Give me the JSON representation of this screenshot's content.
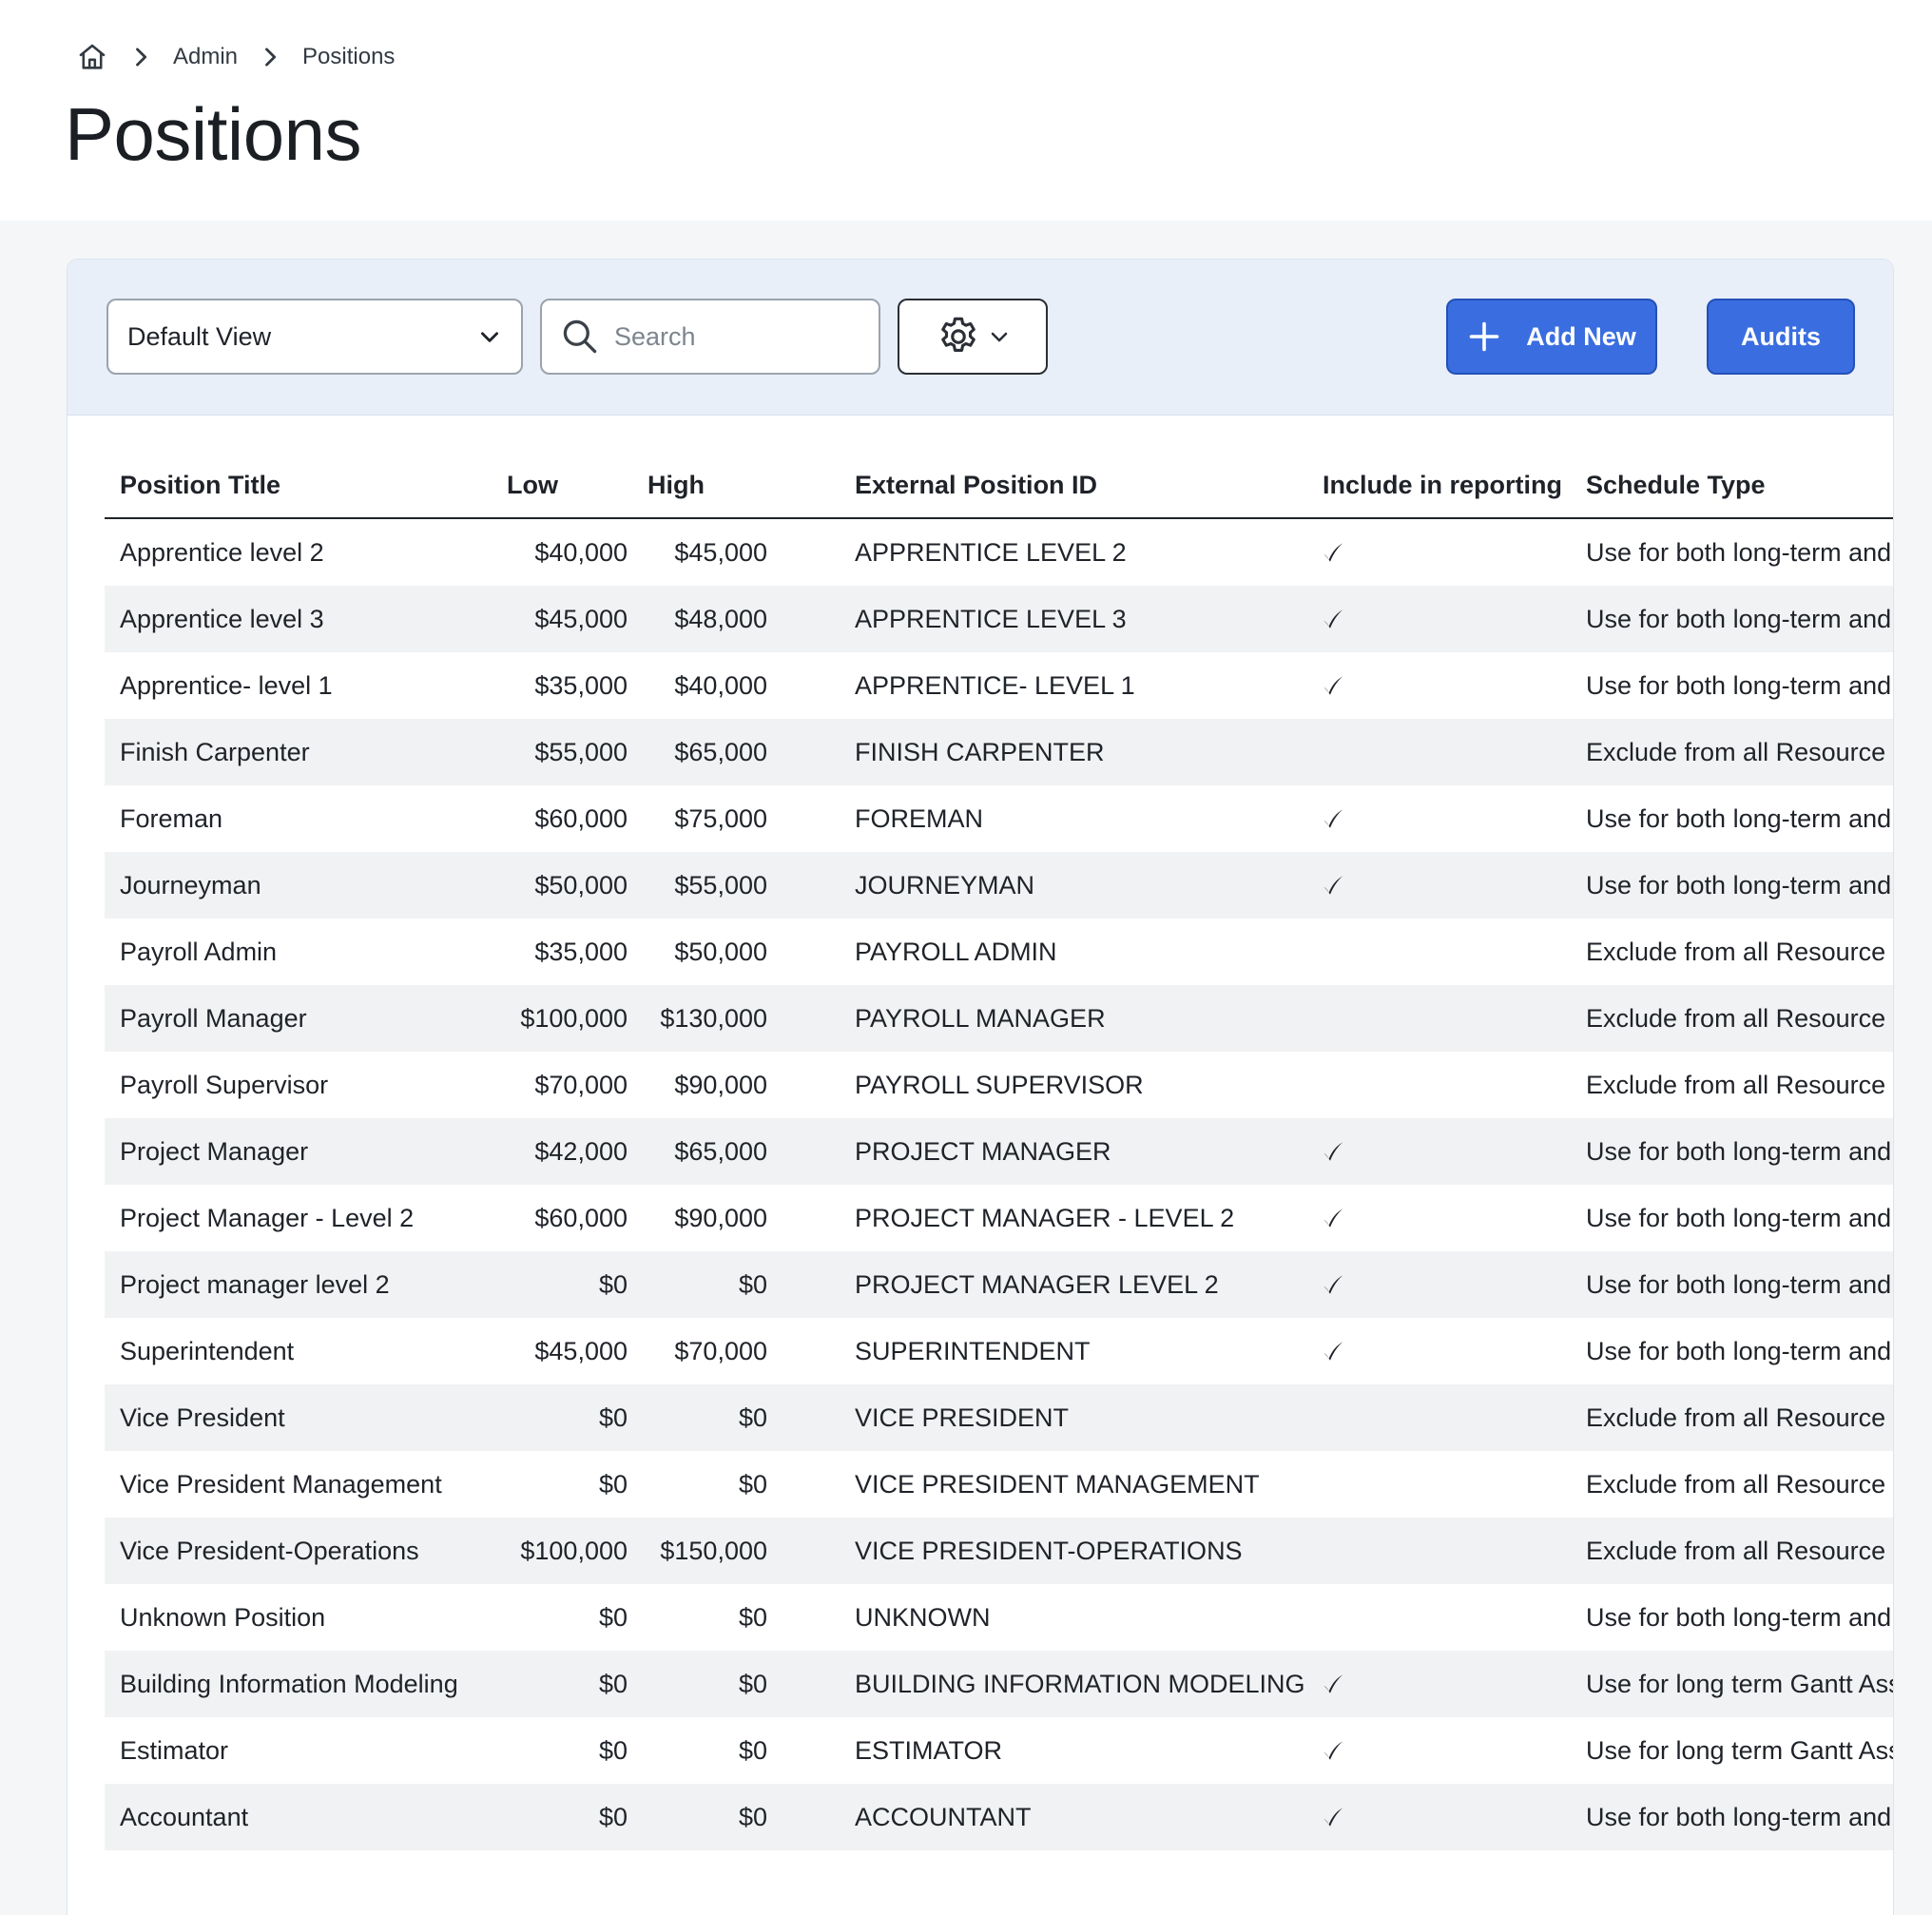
{
  "breadcrumb": {
    "items": [
      "Admin",
      "Positions"
    ]
  },
  "page": {
    "title": "Positions"
  },
  "toolbar": {
    "view_select_value": "Default View",
    "search_placeholder": "Search",
    "add_new_label": "Add New",
    "audits_label": "Audits"
  },
  "colors": {
    "primary": "#3a6ee0",
    "toolbar_bg": "#e8eff9",
    "row_stripe": "#f1f2f3"
  },
  "table": {
    "headers": {
      "title": "Position Title",
      "low": "Low",
      "high": "High",
      "external_id": "External Position ID",
      "reporting": "Include in reporting",
      "schedule": "Schedule Type"
    },
    "rows": [
      {
        "title": "Apprentice level 2",
        "low": "$40,000",
        "high": "$45,000",
        "external_id": "APPRENTICE LEVEL 2",
        "reporting": true,
        "schedule": "Use for both long-term and shor"
      },
      {
        "title": "Apprentice level 3",
        "low": "$45,000",
        "high": "$48,000",
        "external_id": "APPRENTICE LEVEL 3",
        "reporting": true,
        "schedule": "Use for both long-term and shor"
      },
      {
        "title": "Apprentice- level 1",
        "low": "$35,000",
        "high": "$40,000",
        "external_id": "APPRENTICE- LEVEL 1",
        "reporting": true,
        "schedule": "Use for both long-term and shor"
      },
      {
        "title": "Finish Carpenter",
        "low": "$55,000",
        "high": "$65,000",
        "external_id": "FINISH CARPENTER",
        "reporting": false,
        "schedule": "Exclude from all Resource Planr"
      },
      {
        "title": "Foreman",
        "low": "$60,000",
        "high": "$75,000",
        "external_id": "FOREMAN",
        "reporting": true,
        "schedule": "Use for both long-term and shor"
      },
      {
        "title": "Journeyman",
        "low": "$50,000",
        "high": "$55,000",
        "external_id": "JOURNEYMAN",
        "reporting": true,
        "schedule": "Use for both long-term and shor"
      },
      {
        "title": "Payroll Admin",
        "low": "$35,000",
        "high": "$50,000",
        "external_id": "PAYROLL ADMIN",
        "reporting": false,
        "schedule": "Exclude from all Resource Planr"
      },
      {
        "title": "Payroll Manager",
        "low": "$100,000",
        "high": "$130,000",
        "external_id": "PAYROLL MANAGER",
        "reporting": false,
        "schedule": "Exclude from all Resource Planr"
      },
      {
        "title": "Payroll Supervisor",
        "low": "$70,000",
        "high": "$90,000",
        "external_id": "PAYROLL SUPERVISOR",
        "reporting": false,
        "schedule": "Exclude from all Resource Planr"
      },
      {
        "title": "Project Manager",
        "low": "$42,000",
        "high": "$65,000",
        "external_id": "PROJECT MANAGER",
        "reporting": true,
        "schedule": "Use for both long-term and shor"
      },
      {
        "title": "Project Manager - Level 2",
        "low": "$60,000",
        "high": "$90,000",
        "external_id": "PROJECT MANAGER - LEVEL 2",
        "reporting": true,
        "schedule": "Use for both long-term and shor"
      },
      {
        "title": "Project manager level 2",
        "low": "$0",
        "high": "$0",
        "external_id": "PROJECT MANAGER LEVEL 2",
        "reporting": true,
        "schedule": "Use for both long-term and shor"
      },
      {
        "title": "Superintendent",
        "low": "$45,000",
        "high": "$70,000",
        "external_id": "SUPERINTENDENT",
        "reporting": true,
        "schedule": "Use for both long-term and shor"
      },
      {
        "title": "Vice President",
        "low": "$0",
        "high": "$0",
        "external_id": "VICE PRESIDENT",
        "reporting": false,
        "schedule": "Exclude from all Resource Planr"
      },
      {
        "title": "Vice President Management",
        "low": "$0",
        "high": "$0",
        "external_id": "VICE PRESIDENT MANAGEMENT",
        "reporting": false,
        "schedule": "Exclude from all Resource Planr"
      },
      {
        "title": "Vice President-Operations",
        "low": "$100,000",
        "high": "$150,000",
        "external_id": "VICE PRESIDENT-OPERATIONS",
        "reporting": false,
        "schedule": "Exclude from all Resource Planr"
      },
      {
        "title": "Unknown Position",
        "low": "$0",
        "high": "$0",
        "external_id": "UNKNOWN",
        "reporting": false,
        "schedule": "Use for both long-term and shor"
      },
      {
        "title": "Building Information Modeling",
        "low": "$0",
        "high": "$0",
        "external_id": "BUILDING INFORMATION MODELING",
        "reporting": true,
        "schedule": "Use for long term Gantt Assignn"
      },
      {
        "title": "Estimator",
        "low": "$0",
        "high": "$0",
        "external_id": "ESTIMATOR",
        "reporting": true,
        "schedule": "Use for long term Gantt Assignn"
      },
      {
        "title": "Accountant",
        "low": "$0",
        "high": "$0",
        "external_id": "ACCOUNTANT",
        "reporting": true,
        "schedule": "Use for both long-term and shor"
      }
    ]
  }
}
